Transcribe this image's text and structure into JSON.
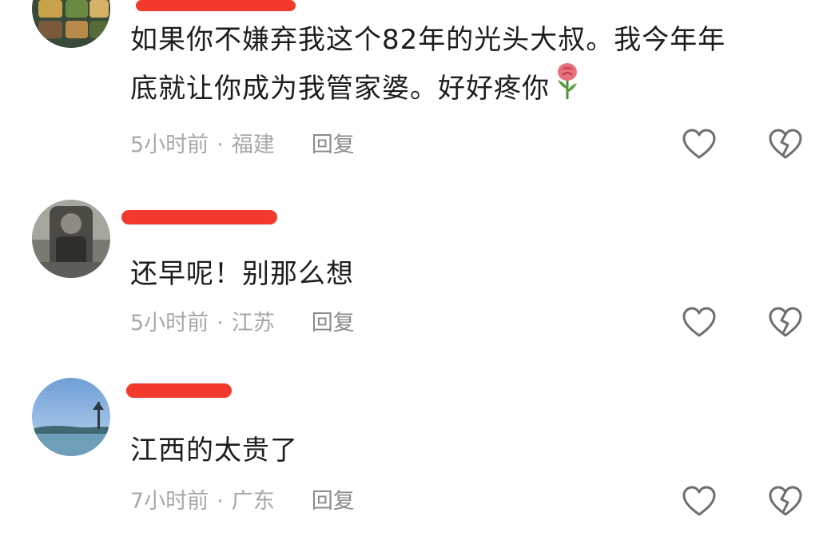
{
  "comments": [
    {
      "text_line1": "如果你不嫌弃我这个82年的光头大叔。我今年年",
      "text_line2": "底就让你成为我管家婆。好好疼你",
      "emoji": "rose-emoji",
      "time": "5小时前",
      "separator": "·",
      "location": "福建",
      "reply": "回复"
    },
    {
      "text_line1": "还早呢！别那么想",
      "time": "5小时前",
      "separator": "·",
      "location": "江苏",
      "reply": "回复"
    },
    {
      "text_line1": "江西的太贵了",
      "time": "7小时前",
      "separator": "·",
      "location": "广东",
      "reply": "回复"
    }
  ],
  "icons": {
    "like": "heart-outline-icon",
    "dislike": "broken-heart-outline-icon"
  },
  "colors": {
    "redaction": "#f23a2c",
    "text": "#1d1d1d",
    "meta": "#a8a8a8"
  }
}
